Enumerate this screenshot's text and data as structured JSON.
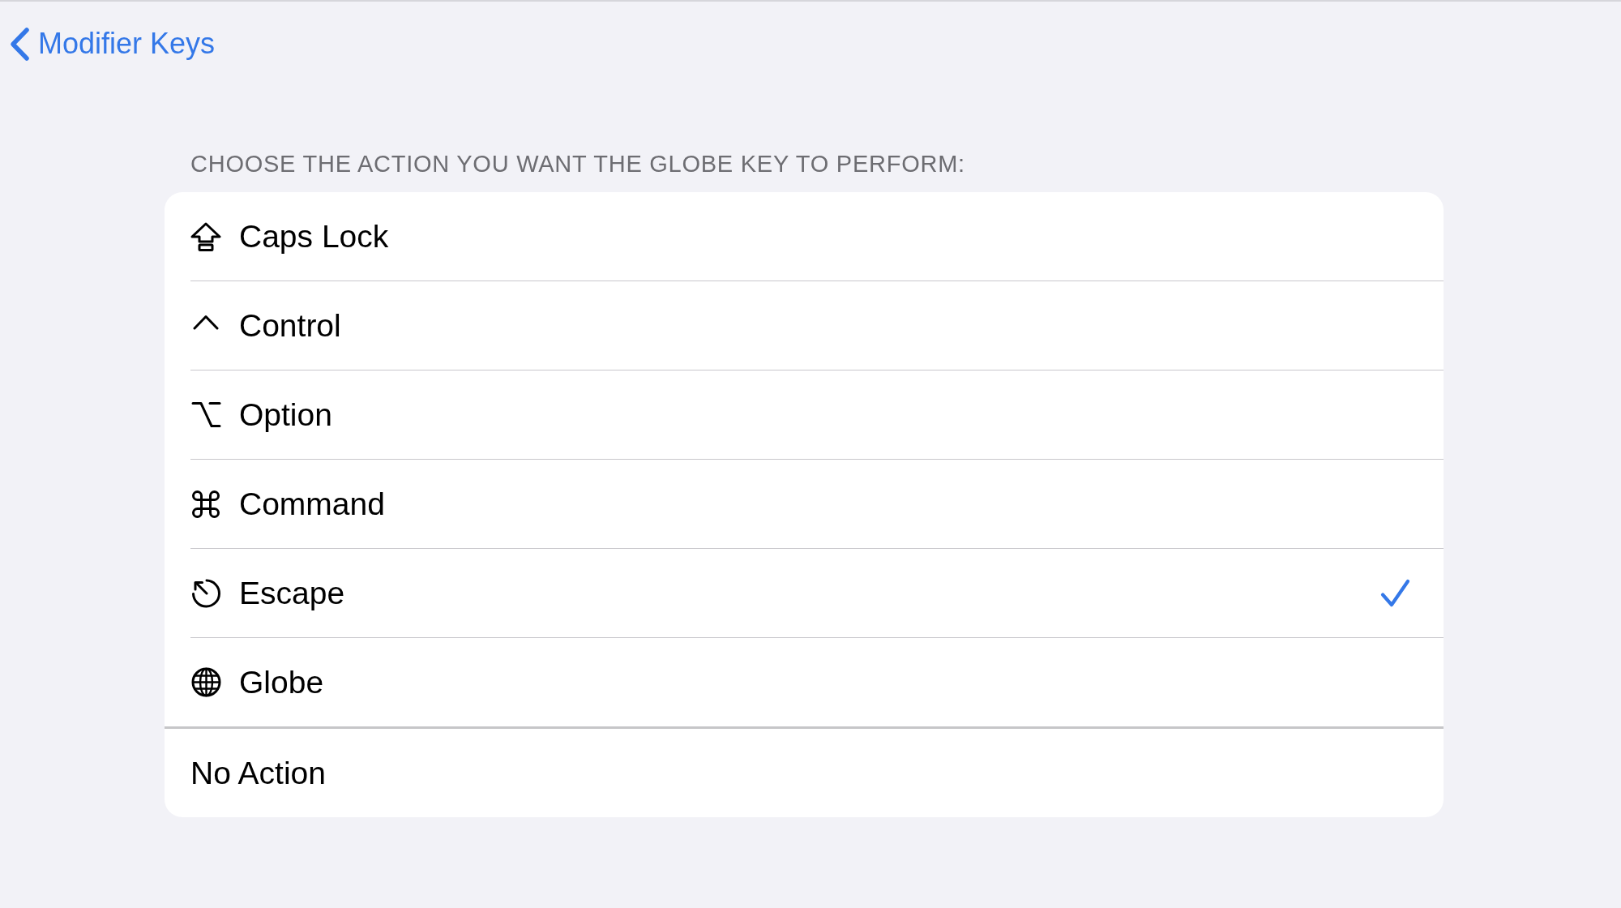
{
  "navigation": {
    "back_label": "Modifier Keys"
  },
  "section_header": "CHOOSE THE ACTION YOU WANT THE GLOBE KEY TO PERFORM:",
  "groups": [
    {
      "options": [
        {
          "kind": "caps-lock",
          "label": "Caps Lock",
          "selected": false
        },
        {
          "kind": "control",
          "label": "Control",
          "selected": false
        },
        {
          "kind": "option",
          "label": "Option",
          "selected": false
        },
        {
          "kind": "command",
          "label": "Command",
          "selected": false
        },
        {
          "kind": "escape",
          "label": "Escape",
          "selected": true
        },
        {
          "kind": "globe",
          "label": "Globe",
          "selected": false
        }
      ]
    },
    {
      "options": [
        {
          "kind": "plain",
          "label": "No Action",
          "selected": false
        }
      ]
    }
  ]
}
